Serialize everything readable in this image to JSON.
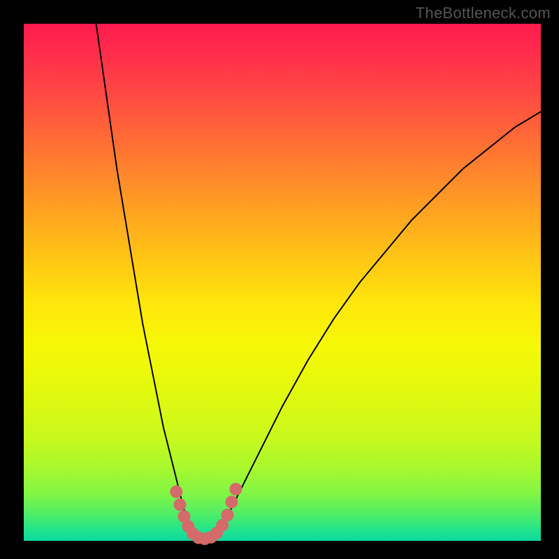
{
  "watermark": "TheBottleneck.com",
  "chart_data": {
    "type": "line",
    "title": "",
    "xlabel": "",
    "ylabel": "",
    "xlim": [
      0,
      100
    ],
    "ylim": [
      0,
      100
    ],
    "grid": false,
    "series": [
      {
        "name": "curve",
        "x": [
          14,
          15,
          16,
          17,
          18,
          19,
          20,
          21,
          22,
          23,
          24,
          25,
          26,
          27,
          28,
          29,
          30,
          31,
          32,
          33,
          34,
          35,
          36,
          37,
          40,
          45,
          50,
          55,
          60,
          65,
          70,
          75,
          80,
          85,
          90,
          95,
          100
        ],
        "values": [
          100,
          93,
          86,
          79,
          72,
          66,
          60,
          54,
          48,
          42,
          37,
          32,
          27,
          22,
          18,
          14,
          10,
          6,
          3,
          1,
          0,
          0,
          0,
          1,
          6,
          16,
          26,
          35,
          43,
          50,
          56,
          62,
          67,
          72,
          76,
          80,
          83
        ],
        "color": "#000000",
        "line_width": 2
      }
    ],
    "markers": [
      {
        "name": "overlay-dots",
        "color": "#d46a6a",
        "size": 18,
        "points": [
          [
            29.5,
            9.5
          ],
          [
            30.2,
            7.0
          ],
          [
            31.0,
            4.7
          ],
          [
            31.8,
            2.8
          ],
          [
            32.7,
            1.4
          ],
          [
            33.8,
            0.6
          ],
          [
            35.0,
            0.4
          ],
          [
            36.2,
            0.7
          ],
          [
            37.3,
            1.5
          ],
          [
            38.4,
            3.0
          ],
          [
            39.4,
            5.0
          ],
          [
            40.2,
            7.5
          ],
          [
            41.0,
            10.0
          ]
        ]
      }
    ]
  }
}
